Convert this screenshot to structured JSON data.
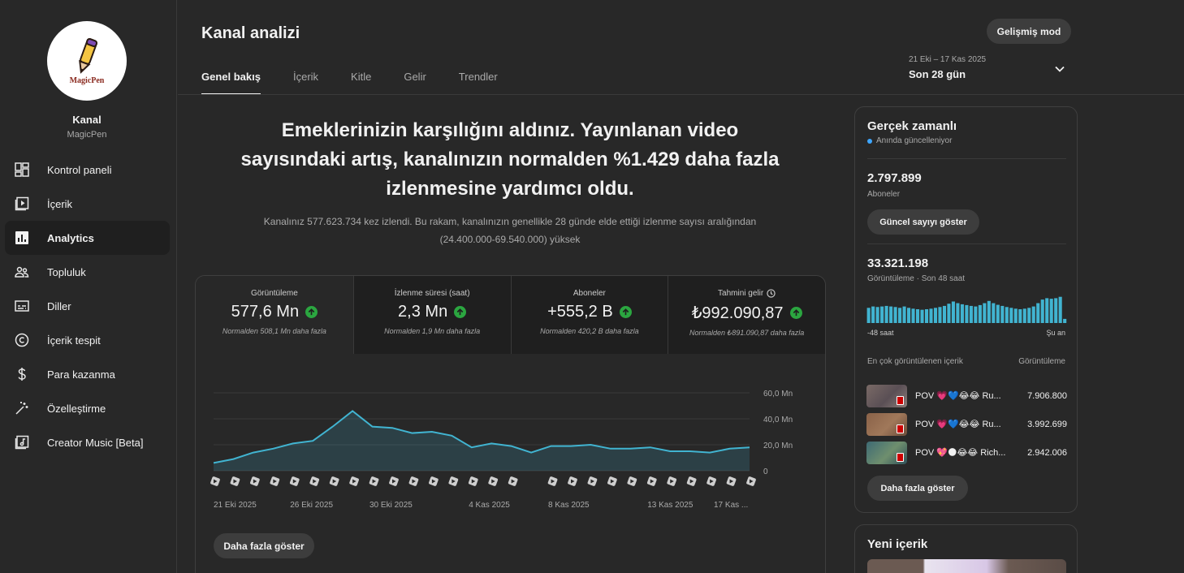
{
  "sidebar": {
    "channel_label": "Kanal",
    "channel_name": "MagicPen",
    "logo_text": "MagicPen",
    "items": [
      {
        "label": "Kontrol paneli",
        "icon": "dashboard-icon"
      },
      {
        "label": "İçerik",
        "icon": "content-icon"
      },
      {
        "label": "Analytics",
        "icon": "analytics-icon",
        "active": true
      },
      {
        "label": "Topluluk",
        "icon": "community-icon"
      },
      {
        "label": "Diller",
        "icon": "subtitles-icon"
      },
      {
        "label": "İçerik tespit",
        "icon": "copyright-icon"
      },
      {
        "label": "Para kazanma",
        "icon": "dollar-icon"
      },
      {
        "label": "Özelleştirme",
        "icon": "magic-wand-icon"
      },
      {
        "label": "Creator Music [Beta]",
        "icon": "music-icon"
      }
    ]
  },
  "header": {
    "title": "Kanal analizi",
    "advanced_mode": "Gelişmiş mod",
    "tabs": [
      "Genel bakış",
      "İçerik",
      "Kitle",
      "Gelir",
      "Trendler"
    ],
    "date_range": "21 Eki – 17 Kas 2025",
    "date_label": "Son 28 gün"
  },
  "headline": "Emeklerinizin karşılığını aldınız. Yayınlanan video sayısındaki artış, kanalınızın normalden %1.429 daha fazla izlenmesine yardımcı oldu.",
  "subline": "Kanalınız 577.623.734 kez izlendi. Bu rakam, kanalınızın genellikle 28 günde elde ettiği izlenme sayısı aralığından (24.400.000-69.540.000) yüksek",
  "metrics": [
    {
      "label": "Görüntüleme",
      "value": "577,6 Mn",
      "note": "Normalden 508,1 Mn daha fazla"
    },
    {
      "label": "İzlenme süresi (saat)",
      "value": "2,3 Mn",
      "note": "Normalden 1,9 Mn daha fazla"
    },
    {
      "label": "Aboneler",
      "value": "+555,2 B",
      "note": "Normalden 420,2 B daha fazla"
    },
    {
      "label": "Tahmini gelir",
      "value": "₺992.090,87",
      "note": "Normalden ₺891.090,87 daha fazla"
    }
  ],
  "main_more": "Daha fazla göster",
  "chart_data": {
    "type": "area",
    "x_tick_labels": [
      "21 Eki 2025",
      "26 Eki 2025",
      "30 Eki 2025",
      "4 Kas 2025",
      "8 Kas 2025",
      "13 Kas 2025",
      "17 Kas ..."
    ],
    "y_tick_labels": [
      "60,0 Mn",
      "40,0 Mn",
      "20,0 Mn",
      "0"
    ],
    "ylim": [
      0,
      60
    ],
    "y_unit": "Mn",
    "series": [
      {
        "values": [
          6,
          9,
          14,
          17,
          21,
          23,
          34,
          46,
          34,
          33,
          29,
          30,
          27,
          18,
          21,
          19,
          14,
          19,
          19,
          20,
          17,
          17,
          18,
          15,
          15,
          14,
          17,
          18
        ]
      }
    ],
    "upload_markers": [
      1,
      1,
      1,
      1,
      1,
      1,
      1,
      1,
      1,
      1,
      1,
      1,
      1,
      1,
      1,
      1,
      0,
      1,
      1,
      1,
      1,
      1,
      1,
      1,
      1,
      1,
      1,
      1
    ],
    "line_color": "#41b4d1",
    "grid": true
  },
  "realtime": {
    "title": "Gerçek zamanlı",
    "live_label": "Anında güncelleniyor",
    "subscribers": "2.797.899",
    "subscribers_label": "Aboneler",
    "show_count_button": "Güncel sayıyı göster",
    "views": "33.321.198",
    "views_label": "Görüntüleme · Son 48 saat",
    "bars": [
      0.55,
      0.6,
      0.58,
      0.6,
      0.62,
      0.6,
      0.58,
      0.55,
      0.6,
      0.55,
      0.52,
      0.5,
      0.48,
      0.5,
      0.52,
      0.55,
      0.58,
      0.62,
      0.7,
      0.78,
      0.72,
      0.68,
      0.65,
      0.62,
      0.6,
      0.65,
      0.72,
      0.8,
      0.72,
      0.66,
      0.62,
      0.58,
      0.55,
      0.52,
      0.5,
      0.52,
      0.55,
      0.6,
      0.72,
      0.85,
      0.9,
      0.88,
      0.9,
      0.95,
      0.15
    ],
    "axis_left": "-48 saat",
    "axis_right": "Şu an",
    "top_label": "En çok görüntülenen içerik",
    "top_col": "Görüntüleme",
    "top_items": [
      {
        "title": "POV 💗💙😂😂 Ru...",
        "value": "7.906.800"
      },
      {
        "title": "POV 💗💙😂😂 Ru...",
        "value": "3.992.699"
      },
      {
        "title": "POV 💖🌑😂😂 Rich...",
        "value": "2.942.006"
      }
    ],
    "more_button": "Daha fazla göster"
  },
  "new_content": {
    "title": "Yeni içerik"
  }
}
